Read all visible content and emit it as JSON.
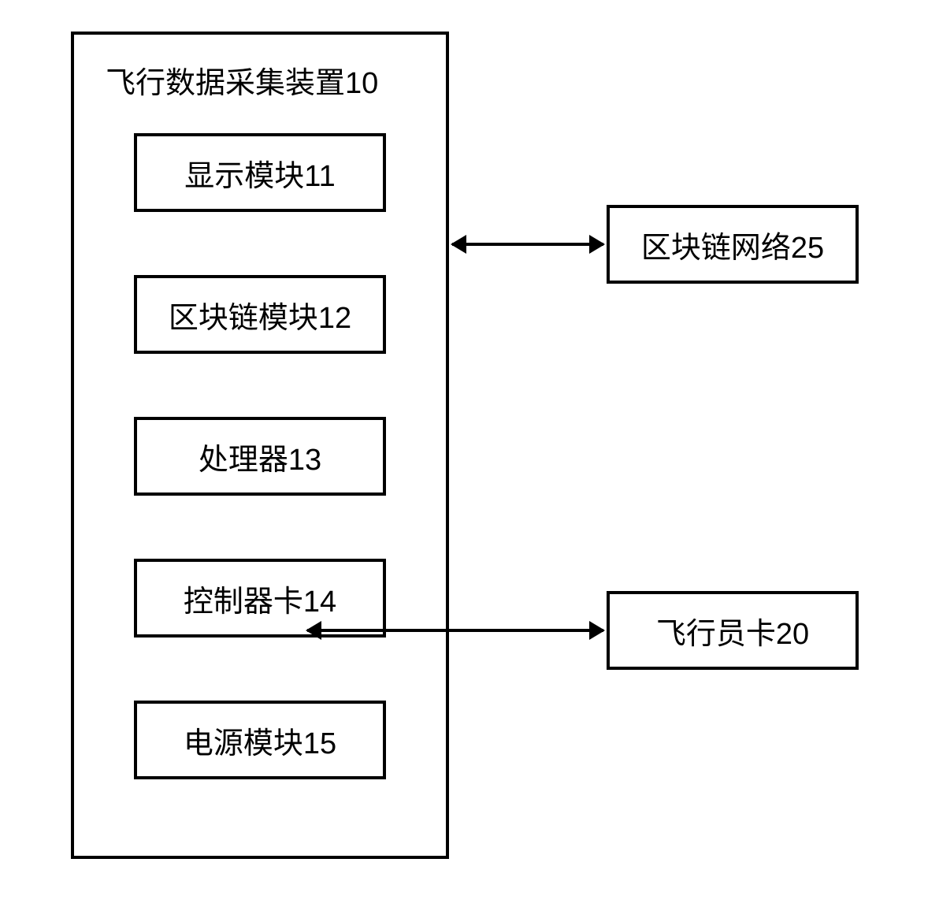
{
  "device": {
    "title": "飞行数据采集装置10",
    "modules": [
      {
        "label": "显示模块11"
      },
      {
        "label": "区块链模块12"
      },
      {
        "label": "处理器13"
      },
      {
        "label": "控制器卡14"
      },
      {
        "label": "电源模块15"
      }
    ]
  },
  "external": {
    "network": "区块链网络25",
    "pilot_card": "飞行员卡20"
  }
}
